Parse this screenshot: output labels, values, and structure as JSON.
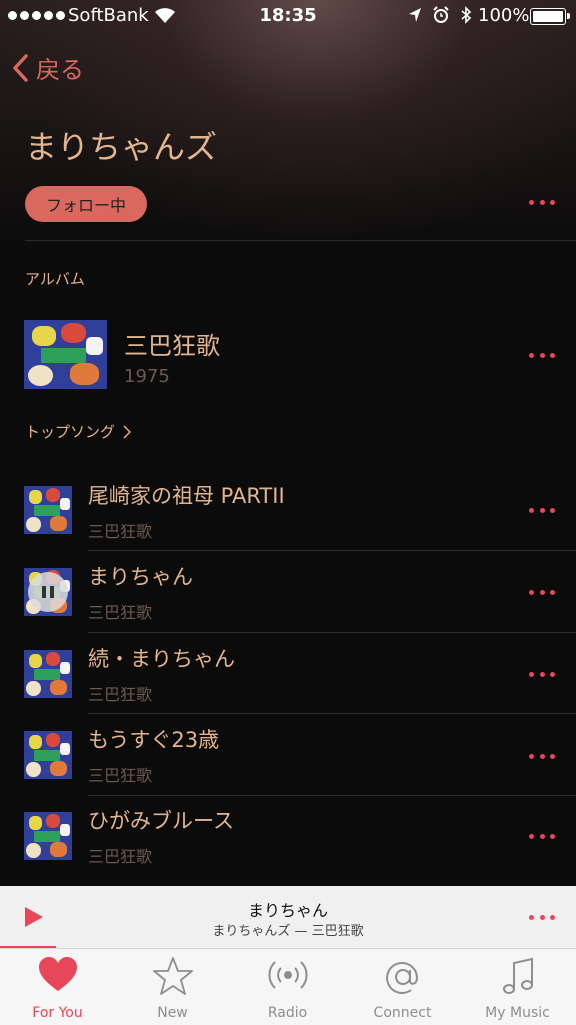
{
  "status_bar": {
    "carrier": "SoftBank",
    "time": "18:35",
    "battery": "100%"
  },
  "nav": {
    "back_label": "戻る"
  },
  "artist": {
    "name": "まりちゃんズ",
    "follow_label": "フォロー中"
  },
  "albums_section": {
    "label": "アルバム",
    "items": [
      {
        "title": "三巴狂歌",
        "year": "1975"
      }
    ]
  },
  "top_songs_section": {
    "label": "トップソング",
    "items": [
      {
        "title": "尾崎家の祖母 PARTII",
        "album": "三巴狂歌"
      },
      {
        "title": "まりちゃん",
        "album": "三巴狂歌",
        "playing": true
      },
      {
        "title": "続・まりちゃん",
        "album": "三巴狂歌"
      },
      {
        "title": "もうすぐ23歳",
        "album": "三巴狂歌"
      },
      {
        "title": "ひがみブルース",
        "album": "三巴狂歌"
      }
    ]
  },
  "mini_player": {
    "title": "まりちゃん",
    "subtitle": "まりちゃんズ — 三巴狂歌"
  },
  "tab_bar": {
    "tabs": [
      {
        "label": "For You",
        "icon": "heart-icon",
        "active": true
      },
      {
        "label": "New",
        "icon": "star-icon"
      },
      {
        "label": "Radio",
        "icon": "radio-icon"
      },
      {
        "label": "Connect",
        "icon": "at-icon"
      },
      {
        "label": "My Music",
        "icon": "music-note-icon"
      }
    ]
  },
  "colors": {
    "accent": "#e8475a",
    "text_gold": "#e2b58f",
    "follow_button": "#d9695f",
    "subtext": "#6d5a4e"
  }
}
